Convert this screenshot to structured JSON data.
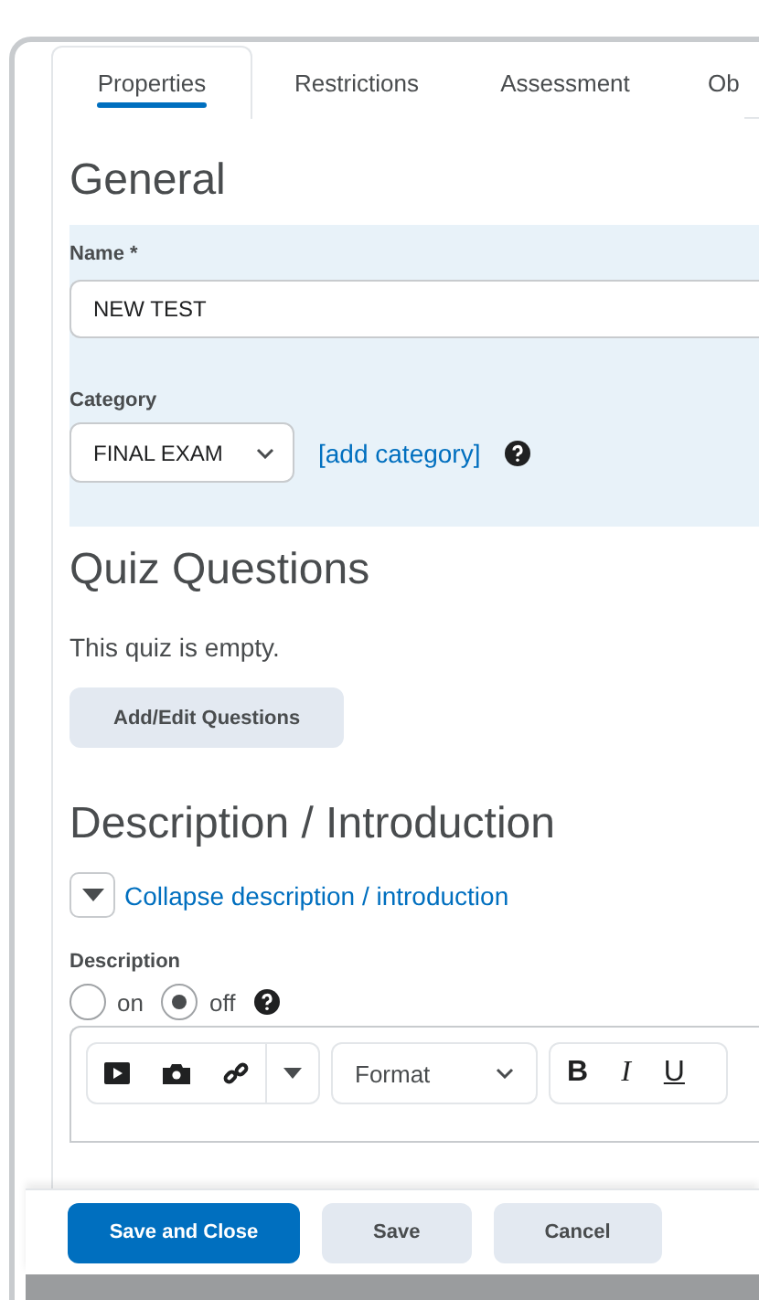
{
  "tabs": [
    {
      "label": "Properties",
      "selected": true
    },
    {
      "label": "Restrictions",
      "selected": false
    },
    {
      "label": "Assessment",
      "selected": false
    },
    {
      "label": "Ob",
      "selected": false
    }
  ],
  "general": {
    "heading": "General",
    "name_label": "Name *",
    "name_value": "NEW TEST",
    "category_label": "Category",
    "category_value": "FINAL EXAM",
    "add_category": "[add category]"
  },
  "quiz": {
    "heading": "Quiz Questions",
    "empty_text": "This quiz is empty.",
    "button": "Add/Edit Questions"
  },
  "description": {
    "heading": "Description / Introduction",
    "collapse": "Collapse description / introduction",
    "label": "Description",
    "radios": [
      {
        "label": "on",
        "selected": false
      },
      {
        "label": "off",
        "selected": true
      }
    ],
    "format": "Format",
    "bold": "B",
    "italic": "I",
    "underline": "U"
  },
  "footer": {
    "buttons": [
      {
        "label": "Save and Close",
        "kind": "primary"
      },
      {
        "label": "Save",
        "kind": "secondary"
      },
      {
        "label": "Cancel",
        "kind": "secondary"
      }
    ]
  }
}
